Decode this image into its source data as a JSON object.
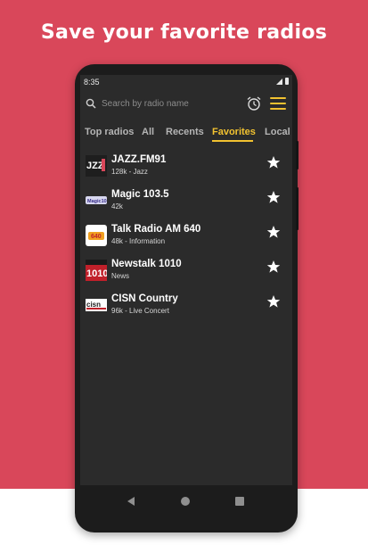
{
  "headline": "Save your favorite radios",
  "status_bar": {
    "time": "8:35"
  },
  "search": {
    "placeholder": "Search by radio name"
  },
  "tabs": [
    {
      "label": "Top radios",
      "active": false
    },
    {
      "label": "All",
      "active": false
    },
    {
      "label": "Recents",
      "active": false
    },
    {
      "label": "Favorites",
      "active": true
    },
    {
      "label": "Local",
      "active": false
    }
  ],
  "stations": [
    {
      "name": "JAZZ.FM91",
      "subtitle": "128k - Jazz",
      "logo_text": "JAZZ91",
      "favorite": true
    },
    {
      "name": "Magic 103.5",
      "subtitle": "42k",
      "logo_text": "Magic 103.5",
      "favorite": true
    },
    {
      "name": "Talk Radio AM 640",
      "subtitle": "48k - Information",
      "logo_text": "640",
      "favorite": true
    },
    {
      "name": "Newstalk 1010",
      "subtitle": "News",
      "logo_text": "1010",
      "favorite": true
    },
    {
      "name": "CISN Country",
      "subtitle": "96k - Live Concert",
      "logo_text": "cisn",
      "favorite": true
    }
  ],
  "colors": {
    "background": "#d9475a",
    "accent": "#f2c230",
    "screen": "#2b2b2b"
  },
  "icons": {
    "search": "search-icon",
    "alarm": "alarm-clock-icon",
    "menu": "hamburger-menu-icon",
    "favorite": "star-icon",
    "nav_back": "triangle-back-icon",
    "nav_home": "circle-home-icon",
    "nav_recent": "square-recent-icon"
  }
}
